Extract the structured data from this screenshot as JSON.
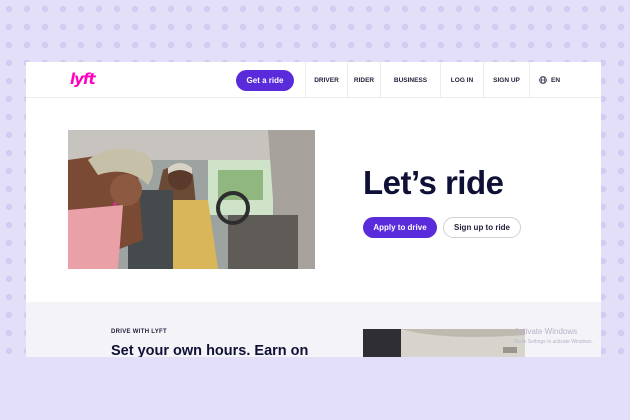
{
  "brand": {
    "logo_text": "lyft",
    "logo_color": "#ff00bf",
    "accent": "#5a2bdb"
  },
  "nav": {
    "cta_label": "Get a ride",
    "items": [
      {
        "label": "DRIVER"
      },
      {
        "label": "RIDER"
      },
      {
        "label": "BUSINESS"
      },
      {
        "label": "LOG IN"
      },
      {
        "label": "SIGN UP"
      }
    ],
    "language_label": "EN"
  },
  "hero": {
    "title": "Let’s ride",
    "primary_button": "Apply to drive",
    "secondary_button": "Sign up to ride"
  },
  "section": {
    "eyebrow": "DRIVE WITH LYFT",
    "headline": "Set your own hours. Earn on"
  },
  "watermark": {
    "title": "Activate Windows",
    "subtitle": "Go to Settings to activate Windows."
  }
}
